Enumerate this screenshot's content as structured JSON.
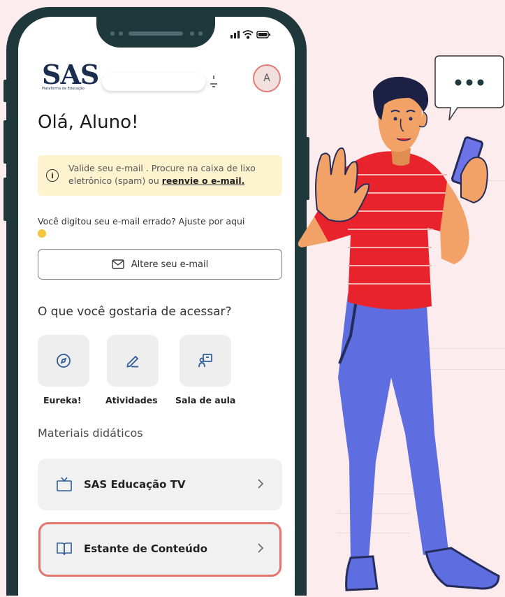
{
  "app": {
    "logo": "SAS",
    "logo_subtitle": "Plataforma de Educação",
    "avatar_initial": "A"
  },
  "greeting": "Olá, Aluno!",
  "alert": {
    "text_before": "Valide seu e-mail . Procure na caixa de lixo eletrônico (spam) ou ",
    "link": "reenvie o e-mail."
  },
  "email_prompt": "Você digitou seu e-mail errado? Ajuste por aqui",
  "change_email_button": "Altere seu e-mail",
  "access_heading": "O que você gostaria de acessar?",
  "shortcuts": [
    {
      "label": "Eureka!",
      "icon": "compass-icon"
    },
    {
      "label": "Atividades",
      "icon": "pencil-icon"
    },
    {
      "label": "Sala de aula",
      "icon": "classroom-icon"
    }
  ],
  "materials_heading": "Materiais didáticos",
  "materials": [
    {
      "label": "SAS Educação TV",
      "icon": "tv-icon"
    },
    {
      "label": "Estante de Conteúdo",
      "icon": "book-icon",
      "highlighted": true
    }
  ],
  "colors": {
    "phone_frame": "#1f383c",
    "alert_background": "#fdf3cf",
    "highlight": "#e2766f",
    "accent_blue": "#2f5d9a",
    "background": "#fdeced"
  }
}
